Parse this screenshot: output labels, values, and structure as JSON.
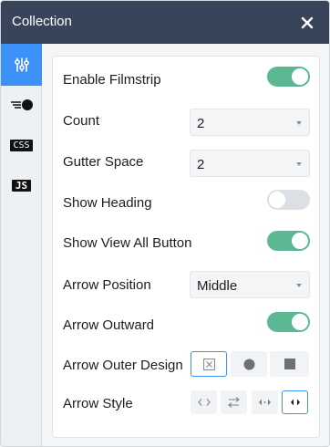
{
  "header": {
    "title": "Collection",
    "close_icon": "close-icon"
  },
  "sidebar": {
    "items": [
      {
        "name": "settings-sliders",
        "icon": "sliders-icon",
        "active": true
      },
      {
        "name": "style",
        "icon": "style-icon",
        "active": false
      },
      {
        "name": "css",
        "label": "CSS",
        "active": false
      },
      {
        "name": "js",
        "label": "JS",
        "active": false
      }
    ]
  },
  "settings": {
    "enable_filmstrip": {
      "label": "Enable Filmstrip",
      "on": true
    },
    "count": {
      "label": "Count",
      "value": "2"
    },
    "gutter_space": {
      "label": "Gutter Space",
      "value": "2"
    },
    "show_heading": {
      "label": "Show Heading",
      "on": false
    },
    "show_view_all": {
      "label": "Show View All Button",
      "on": true
    },
    "arrow_position": {
      "label": "Arrow Position",
      "value": "Middle"
    },
    "arrow_outward": {
      "label": "Arrow Outward",
      "on": true
    },
    "arrow_outer_design": {
      "label": "Arrow Outer Design",
      "options": [
        "none-icon",
        "circle-icon",
        "square-icon"
      ],
      "selected": 0
    },
    "arrow_style": {
      "label": "Arrow Style",
      "options": [
        "angle-brackets-icon",
        "swap-arrows-icon",
        "filled-arrows-icon",
        "filled-arrows-outward-icon"
      ],
      "selected": 3
    }
  },
  "colors": {
    "header_bg": "#384459",
    "accent": "#3b91f7",
    "toggle_on": "#5bb892",
    "toggle_off": "#dcdfe3"
  }
}
